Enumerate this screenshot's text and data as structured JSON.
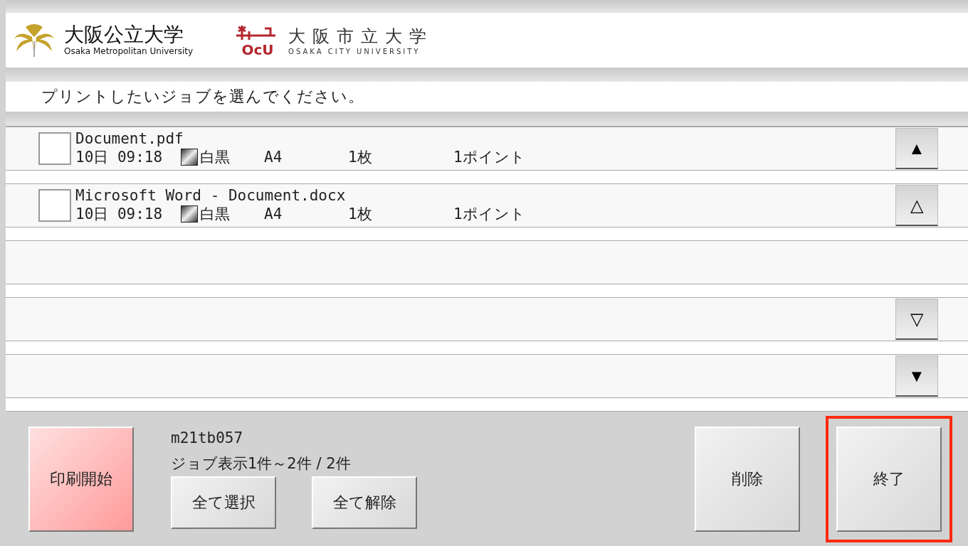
{
  "header": {
    "logo_1": {
      "name": "大阪公立大学",
      "subtitle": "Osaka Metropolitan University"
    },
    "logo_2": {
      "mark": "OcU",
      "name": "大阪市立大学",
      "subtitle": "OSAKA CITY UNIVERSITY"
    }
  },
  "instruction": "プリントしたいジョブを選んでください。",
  "jobs": [
    {
      "name": "Document.pdf",
      "date": "10日 09:18",
      "color_mode": "白黒",
      "paper": "A4",
      "copies": "1枚",
      "points": "1ポイント",
      "checked": false
    },
    {
      "name": "Microsoft Word - Document.docx",
      "date": "10日 09:18",
      "color_mode": "白黒",
      "paper": "A4",
      "copies": "1枚",
      "points": "1ポイント",
      "checked": false
    }
  ],
  "scroll_buttons": [
    {
      "kind": "first",
      "label": "▲"
    },
    {
      "kind": "prev",
      "label": "△"
    },
    {
      "kind": "next",
      "label": "▽"
    },
    {
      "kind": "last",
      "label": "▼"
    }
  ],
  "footer": {
    "start_button": "印刷開始",
    "user_id": "m21tb057",
    "job_count": "ジョブ表示1件～2件 / 2件",
    "select_all": "全て選択",
    "deselect_all": "全て解除",
    "delete_button": "削除",
    "exit_button": {
      "label": "終了",
      "highlighted": true
    }
  }
}
